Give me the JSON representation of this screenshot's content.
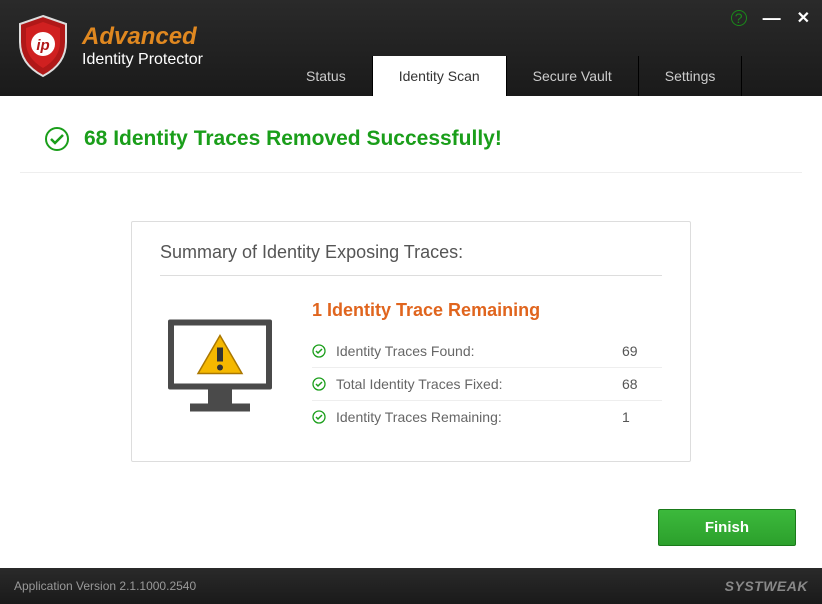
{
  "brand": {
    "title": "Advanced",
    "subtitle": "Identity Protector"
  },
  "tabs": {
    "status": "Status",
    "scan": "Identity Scan",
    "vault": "Secure Vault",
    "settings": "Settings"
  },
  "success_message": "68 Identity Traces Removed Successfully!",
  "summary": {
    "title": "Summary of Identity Exposing Traces:",
    "remaining_title": "1 Identity Trace Remaining",
    "rows": [
      {
        "label": "Identity Traces Found:",
        "value": "69"
      },
      {
        "label": "Total Identity Traces Fixed:",
        "value": "68"
      },
      {
        "label": "Identity Traces Remaining:",
        "value": "1"
      }
    ]
  },
  "finish_button": "Finish",
  "footer": {
    "version": "Application Version 2.1.1000.2540",
    "vendor": "SYSTWEAK"
  }
}
